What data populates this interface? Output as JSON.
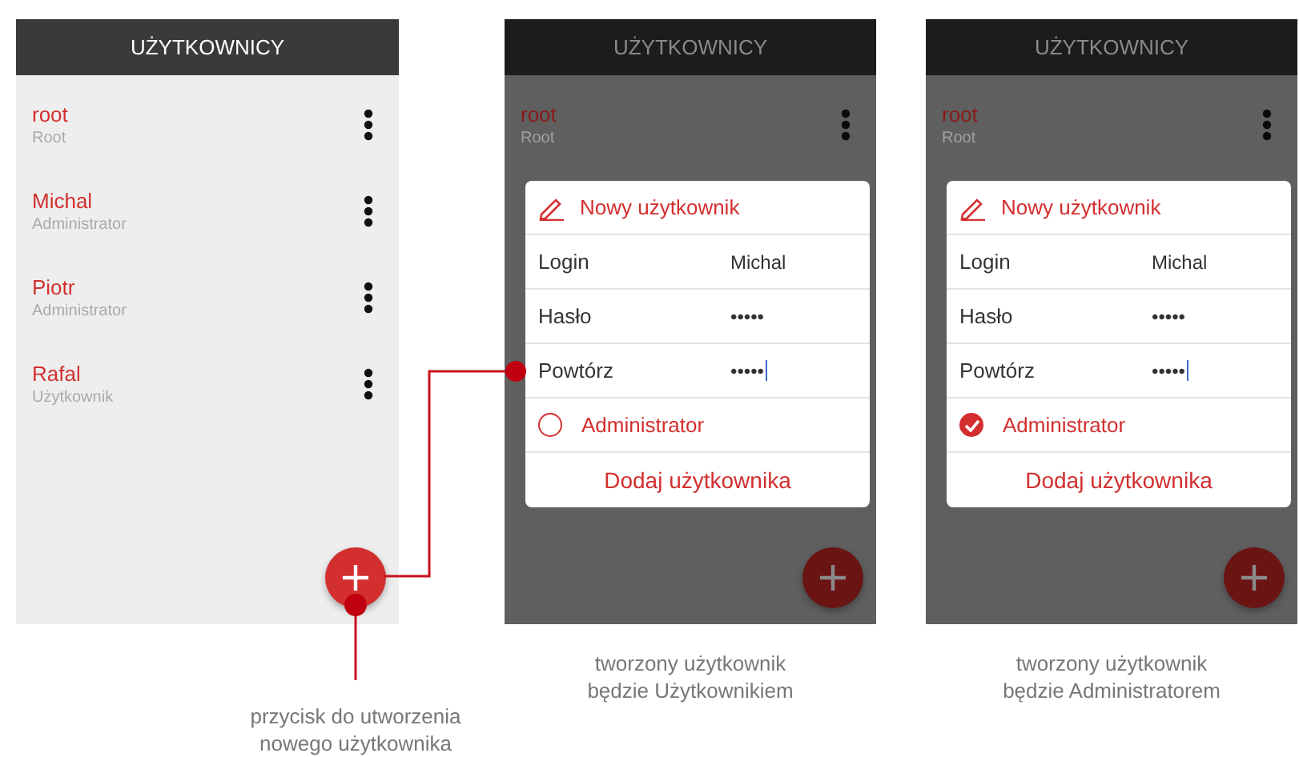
{
  "screens": [
    {
      "header": "UŻYTKOWNICY",
      "dimmed": false,
      "users": [
        {
          "name": "root",
          "role": "Root"
        },
        {
          "name": "Michal",
          "role": "Administrator"
        },
        {
          "name": "Piotr",
          "role": "Administrator"
        },
        {
          "name": "Rafal",
          "role": "Użytkownik"
        }
      ],
      "caption": "przycisk do utworzenia nowego użytkownika"
    },
    {
      "header": "UŻYTKOWNICY",
      "dimmed": true,
      "users": [
        {
          "name": "root",
          "role": "Root"
        }
      ],
      "dialog": {
        "title": "Nowy użytkownik",
        "fields": [
          {
            "label": "Login",
            "value": "Michal",
            "focused": false
          },
          {
            "label": "Hasło",
            "value": "•••••",
            "focused": false
          },
          {
            "label": "Powtórz",
            "value": "•••••",
            "focused": true
          }
        ],
        "admin": {
          "label": "Administrator",
          "checked": false
        },
        "submit": "Dodaj użytkownika"
      },
      "caption": "tworzony użytkownik będzie Użytkownikiem"
    },
    {
      "header": "UŻYTKOWNICY",
      "dimmed": true,
      "users": [
        {
          "name": "root",
          "role": "Root"
        }
      ],
      "dialog": {
        "title": "Nowy użytkownik",
        "fields": [
          {
            "label": "Login",
            "value": "Michal",
            "focused": false
          },
          {
            "label": "Hasło",
            "value": "•••••",
            "focused": false
          },
          {
            "label": "Powtórz",
            "value": "•••••",
            "focused": true
          }
        ],
        "admin": {
          "label": "Administrator",
          "checked": true
        },
        "submit": "Dodaj użytkownika"
      },
      "caption": "tworzony użytkownik będzie Administratorem"
    }
  ]
}
